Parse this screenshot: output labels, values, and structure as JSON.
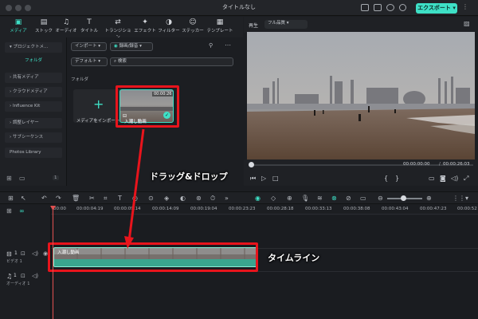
{
  "window": {
    "title": "タイトルなし",
    "export_label": "エクスポート"
  },
  "tabs": [
    {
      "label": "メディア",
      "icon": "media-icon",
      "active": true
    },
    {
      "label": "ストック",
      "icon": "stock-icon"
    },
    {
      "label": "オーディオ",
      "icon": "audio-icon"
    },
    {
      "label": "タイトル",
      "icon": "title-icon"
    },
    {
      "label": "トランジション",
      "icon": "transition-icon"
    },
    {
      "label": "エフェクト",
      "icon": "effect-icon"
    },
    {
      "label": "フィルター",
      "icon": "filter-icon"
    },
    {
      "label": "ステッカー",
      "icon": "sticker-icon"
    },
    {
      "label": "テンプレート",
      "icon": "template-icon"
    }
  ],
  "sidebar": {
    "items": [
      {
        "label": "プロジェクトメ..."
      },
      {
        "label": "フォルダ",
        "active": true
      },
      {
        "label": "共有メディア"
      },
      {
        "label": "クラウドメディア"
      },
      {
        "label": "Influence Kit"
      },
      {
        "label": "調整レイヤー"
      },
      {
        "label": "サブシーケンス"
      },
      {
        "label": "Photos Library"
      }
    ],
    "folder_count": "1"
  },
  "media": {
    "import_label": "インポート",
    "record_label": "録画/録音",
    "default_label": "デフォルト",
    "search_placeholder": "検索",
    "folder_label": "フォルダ",
    "import_media_label": "メディアをインポート",
    "clip_name": "入潮し動画",
    "clip_duration": "00:00:26"
  },
  "preview": {
    "play_label": "再生",
    "quality_label": "フル品質",
    "current_time": "00:00:00:00",
    "separator": "/",
    "total_time": "00:00:26:03"
  },
  "timeline": {
    "ruler_labels": [
      "00:00",
      "00:00:04:19",
      "00:00:09:14",
      "00:00:14:09",
      "00:00:19:04",
      "00:00:23:23",
      "00:00:28:18",
      "00:00:33:13",
      "00:00:38:08",
      "00:00:43:04",
      "00:00:47:23",
      "00:00:52"
    ],
    "video_track_label": "ビデオ 1",
    "audio_track_label": "オーディオ 1",
    "video_track_num": "1",
    "audio_track_num": "1",
    "clip_label": "入潮し動画"
  },
  "annotations": {
    "drag_drop": "ドラッグ&ドロップ",
    "timeline": "タイムライン"
  },
  "colors": {
    "accent": "#3ee0c6",
    "highlight_red": "#e8141c",
    "playhead": "#e05050",
    "clip_teal": "#3aa58f"
  }
}
